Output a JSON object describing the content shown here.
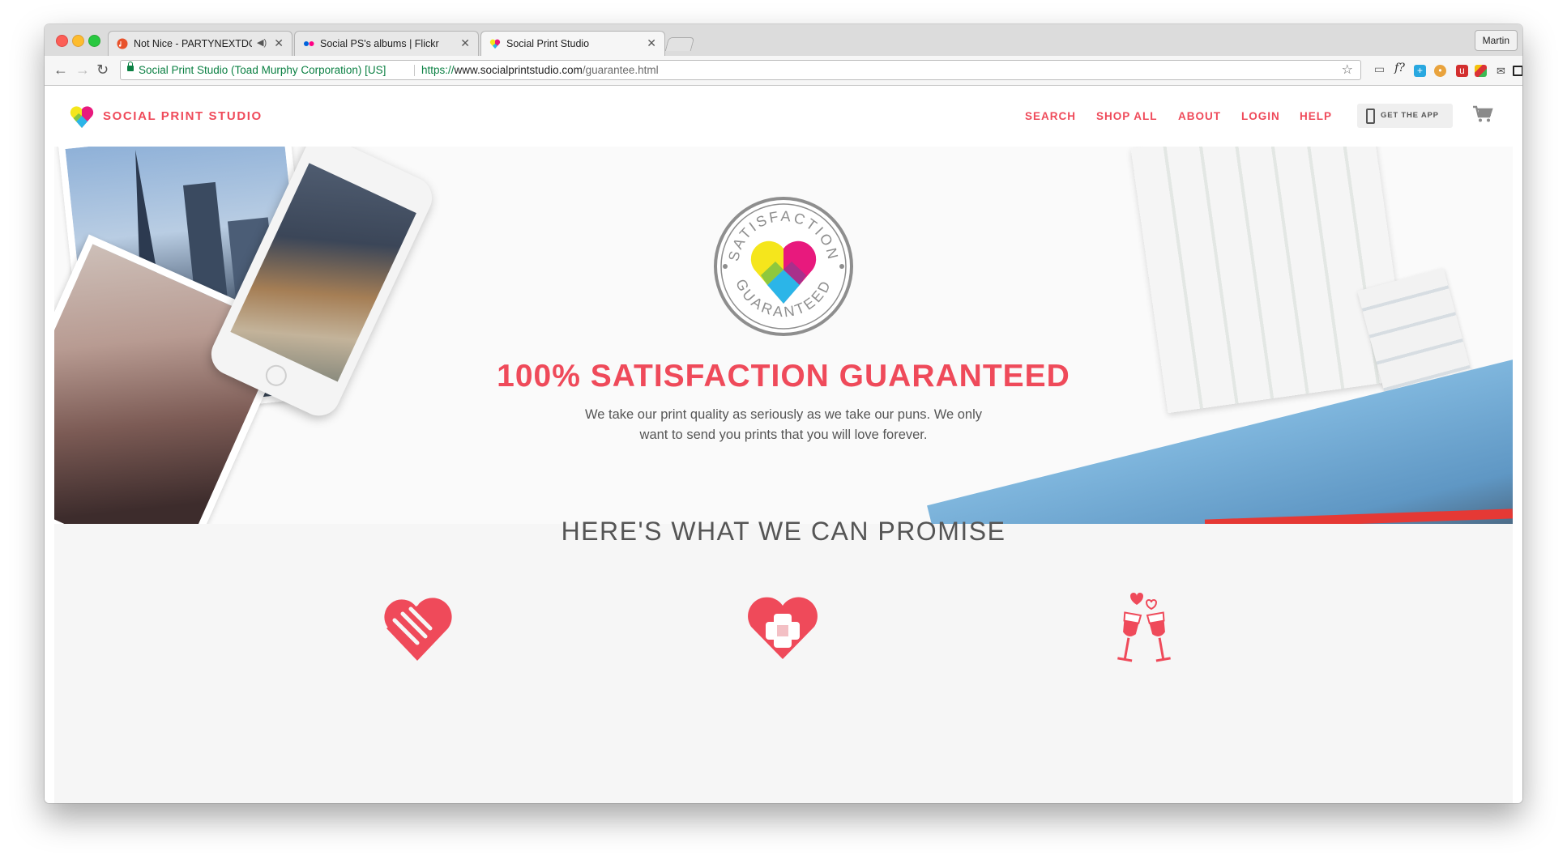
{
  "browser": {
    "tabs": [
      {
        "title": "Not Nice - PARTYNEXTDOOR",
        "audio_icon": "speaker-icon",
        "active": false
      },
      {
        "title": "Social PS's albums | Flickr",
        "active": false
      },
      {
        "title": "Social Print Studio",
        "active": true
      }
    ],
    "profile": "Martin",
    "ev_cert": "Social Print Studio (Toad Murphy Corporation) [US]",
    "url_scheme": "https://",
    "url_host": "www.socialprintstudio.com",
    "url_path": "/guarantee.html"
  },
  "site": {
    "brand": "SOCIAL PRINT STUDIO",
    "nav": [
      "SEARCH",
      "SHOP ALL",
      "ABOUT",
      "LOGIN",
      "HELP"
    ],
    "get_app": "GET THE APP"
  },
  "hero": {
    "badge_top": "SATISFACTION",
    "badge_bottom": "GUARANTEED",
    "headline": "100% SATISFACTION GUARANTEED",
    "subline": "We take our print quality as seriously as we take our puns. We only want to send you prints that you will love forever."
  },
  "promise": {
    "title": "HERE'S WHAT WE CAN PROMISE",
    "icons": [
      "heart-handshake-icon",
      "heart-bandage-icon",
      "wine-toast-icon"
    ]
  },
  "colors": {
    "brand": "#ef4a5a",
    "secure": "#0b8043"
  }
}
